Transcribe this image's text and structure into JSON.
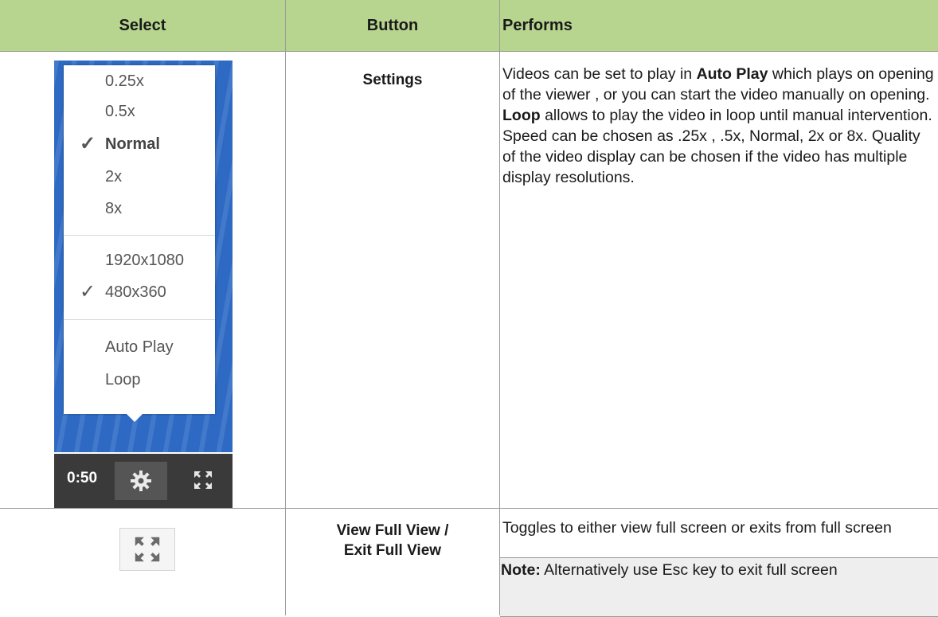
{
  "table": {
    "headers": [
      "Select",
      "Button",
      "Performs"
    ],
    "rows": [
      {
        "button": "Settings",
        "performs_parts": [
          "Videos can be set to play in ",
          "Auto Play",
          " which plays on opening of the viewer , or you can start the video manually on opening. ",
          "Loop",
          "  allows to play the video in loop until manual intervention. Speed can be chosen as .25x , .5x, Normal, 2x or 8x. Quality of the video display can be chosen if the video has multiple display resolutions."
        ]
      },
      {
        "button_line1": "View Full View /",
        "button_line2": "Exit Full View",
        "performs": "Toggles to either view full screen or exits from full screen",
        "note_label": "Note:",
        "note_text": "  Alternatively use Esc key to exit full screen"
      }
    ]
  },
  "settings_menu": {
    "speeds": [
      "0.25x",
      "0.5x",
      "Normal",
      "2x",
      "8x"
    ],
    "selected_speed": "Normal",
    "resolutions": [
      "1920x1080",
      "480x360"
    ],
    "selected_resolution": "480x360",
    "toggles": [
      "Auto Play",
      "Loop"
    ],
    "check_glyph": "✓",
    "time": "0:50",
    "gear_glyph": "✲"
  },
  "colors": {
    "header_bg": "#b7d58f",
    "video_bg": "#2e6ac4",
    "controls_bg": "#3a3a3a",
    "note_bg": "#eeeeee"
  },
  "icons": {
    "settings": "gear-icon",
    "fullscreen": "fullscreen-icon"
  }
}
